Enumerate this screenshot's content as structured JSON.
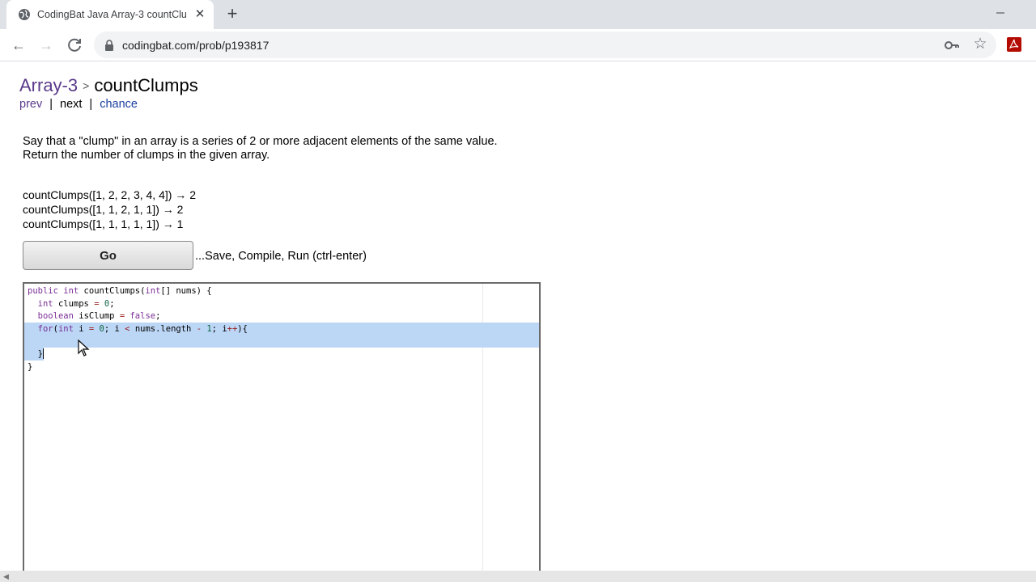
{
  "browser": {
    "tab_title": "CodingBat Java Array-3 countClu",
    "url": "codingbat.com/prob/p193817"
  },
  "page": {
    "breadcrumb_parent": "Array-3",
    "breadcrumb_sep": ">",
    "title": "countClumps",
    "nav": {
      "prev": "prev",
      "next": "next",
      "chance": "chance",
      "sep": "|"
    },
    "description": "Say that a \"clump\" in an array is a series of 2 or more adjacent elements of the same value. Return the number of clumps in the given array.",
    "examples": [
      "countClumps([1, 2, 2, 3, 4, 4]) → 2",
      "countClumps([1, 1, 2, 1, 1]) → 2",
      "countClumps([1, 1, 1, 1, 1]) → 1"
    ],
    "go_label": "Go",
    "go_hint": "...Save, Compile, Run (ctrl-enter)"
  },
  "editor": {
    "lines": [
      "public int countClumps(int[] nums) {",
      "  int clumps = 0;",
      "  boolean isClump = false;",
      "  for(int i = 0; i < nums.length - 1; i++){",
      "  ",
      "  }",
      "}"
    ]
  }
}
